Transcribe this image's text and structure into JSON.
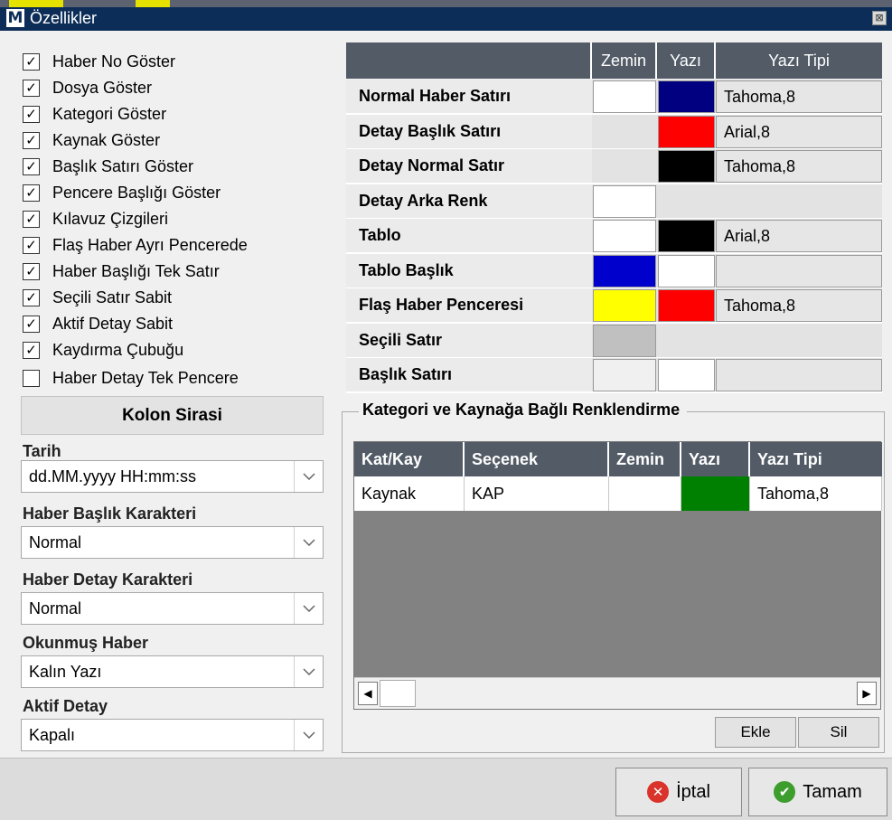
{
  "window": {
    "title": "Özellikler",
    "logo": "M"
  },
  "checkboxes": [
    {
      "label": "Haber No Göster",
      "checked": true
    },
    {
      "label": "Dosya Göster",
      "checked": true
    },
    {
      "label": "Kategori Göster",
      "checked": true
    },
    {
      "label": "Kaynak Göster",
      "checked": true
    },
    {
      "label": "Başlık Satırı Göster",
      "checked": true
    },
    {
      "label": "Pencere Başlığı Göster",
      "checked": true
    },
    {
      "label": "Kılavuz Çizgileri",
      "checked": true
    },
    {
      "label": "Flaş Haber Ayrı Pencerede",
      "checked": true
    },
    {
      "label": "Haber Başlığı Tek Satır",
      "checked": true
    },
    {
      "label": "Seçili Satır Sabit",
      "checked": true
    },
    {
      "label": "Aktif Detay Sabit",
      "checked": true
    },
    {
      "label": "Kaydırma Çubuğu",
      "checked": true
    },
    {
      "label": "Haber Detay Tek Pencere",
      "checked": false
    }
  ],
  "column_order_button": "Kolon Sirasi",
  "fields": [
    {
      "label": "Tarih",
      "value": "dd.MM.yyyy HH:mm:ss"
    },
    {
      "label": "Haber Başlık Karakteri",
      "value": "Normal"
    },
    {
      "label": "Haber Detay Karakteri",
      "value": "Normal"
    },
    {
      "label": "Okunmuş Haber",
      "value": "Kalın Yazı"
    },
    {
      "label": "Aktif Detay",
      "value": "Kapalı"
    }
  ],
  "style_grid": {
    "headers": {
      "zemin": "Zemin",
      "yazi": "Yazı",
      "yazi_tipi": "Yazı Tipi"
    },
    "rows": [
      {
        "label": "Normal Haber Satırı",
        "zemin": "#ffffff",
        "yazi": "#000080",
        "font": "Tahoma,8"
      },
      {
        "label": "Detay Başlık Satırı",
        "zemin": null,
        "yazi": "#ff0000",
        "font": "Arial,8"
      },
      {
        "label": "Detay Normal Satır",
        "zemin": null,
        "yazi": "#000000",
        "font": "Tahoma,8"
      },
      {
        "label": "Detay Arka Renk",
        "zemin": "#ffffff",
        "yazi": null,
        "font": null
      },
      {
        "label": "Tablo",
        "zemin": "#ffffff",
        "yazi": "#000000",
        "font": "Arial,8"
      },
      {
        "label": "Tablo Başlık",
        "zemin": "#0000cc",
        "yazi": "#ffffff",
        "font": ""
      },
      {
        "label": "Flaş Haber Penceresi",
        "zemin": "#ffff00",
        "yazi": "#ff0000",
        "font": "Tahoma,8"
      },
      {
        "label": "Seçili Satır",
        "zemin": "#c0c0c0",
        "yazi": null,
        "font": null
      },
      {
        "label": "Başlık Satırı",
        "zemin": "#f0f0f0",
        "yazi": "#ffffff",
        "font": ""
      }
    ]
  },
  "category_group": {
    "title": "Kategori ve Kaynağa Bağlı Renklendirme",
    "columns": [
      "Kat/Kay",
      "Seçenek",
      "Zemin",
      "Yazı",
      "Yazı Tipi"
    ],
    "rows": [
      {
        "kat_kay": "Kaynak",
        "secenek": "KAP",
        "zemin": "#ffffff",
        "yazi": "#008000",
        "font": "Tahoma,8"
      }
    ],
    "add_button": "Ekle",
    "delete_button": "Sil"
  },
  "footer": {
    "cancel": "İptal",
    "ok": "Tamam"
  }
}
